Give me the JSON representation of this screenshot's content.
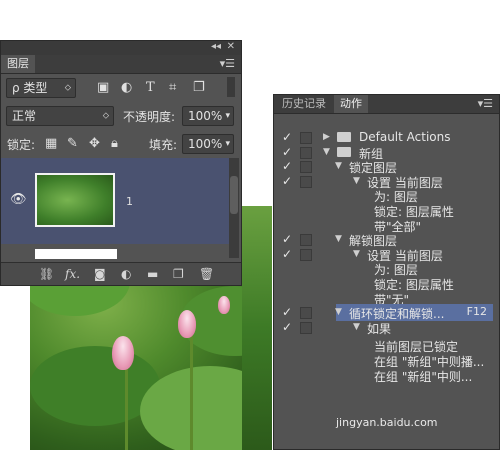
{
  "layers_panel": {
    "tab_label": "图层",
    "filter": {
      "label": "ρ 类型",
      "arrow": "⬦"
    },
    "filter_icons": [
      "image-filter-icon",
      "adjustment-filter-icon",
      "type-filter-icon",
      "shape-filter-icon",
      "smart-object-filter-icon"
    ],
    "blend_mode": "正常",
    "opacity_label": "不透明度:",
    "opacity_value": "100%",
    "lock_label": "锁定:",
    "fill_label": "填充:",
    "fill_value": "100%",
    "layer": {
      "name": "1"
    },
    "bottom_icons": [
      "link-icon",
      "fx-icon",
      "mask-icon",
      "adjustment-icon",
      "folder-icon",
      "new-layer-icon",
      "trash-icon"
    ]
  },
  "actions_panel": {
    "tabs": [
      "历史记录",
      "动作"
    ],
    "rows": [
      {
        "check": "✓",
        "indent": 0,
        "expand": "▶",
        "folder": true,
        "text": "Default Actions"
      },
      {
        "check": "✓",
        "indent": 0,
        "expand": "▼",
        "folder": true,
        "text": "新组"
      },
      {
        "check": "✓",
        "indent": 1,
        "expand": "▼",
        "folder": false,
        "text": "锁定图层"
      },
      {
        "check": "✓",
        "indent": 2,
        "expand": "▼",
        "folder": false,
        "text": "设置 当前图层"
      },
      {
        "check": "",
        "indent": 3,
        "expand": "",
        "folder": false,
        "text": "为: 图层"
      },
      {
        "check": "",
        "indent": 3,
        "expand": "",
        "folder": false,
        "text": "锁定: 图层属性"
      },
      {
        "check": "",
        "indent": 3,
        "expand": "",
        "folder": false,
        "text": "带\"全部\""
      },
      {
        "check": "✓",
        "indent": 1,
        "expand": "▼",
        "folder": false,
        "text": "解锁图层"
      },
      {
        "check": "✓",
        "indent": 2,
        "expand": "▼",
        "folder": false,
        "text": "设置 当前图层"
      },
      {
        "check": "",
        "indent": 3,
        "expand": "",
        "folder": false,
        "text": "为: 图层"
      },
      {
        "check": "",
        "indent": 3,
        "expand": "",
        "folder": false,
        "text": "锁定: 图层属性"
      },
      {
        "check": "",
        "indent": 3,
        "expand": "",
        "folder": false,
        "text": "带\"无\""
      },
      {
        "check": "✓",
        "indent": 1,
        "expand": "▼",
        "folder": false,
        "text": "循环锁定和解锁...",
        "selected": true,
        "fkey": "F12"
      },
      {
        "check": "✓",
        "indent": 2,
        "expand": "▼",
        "folder": false,
        "text": "如果"
      },
      {
        "check": "",
        "indent": 3,
        "expand": "",
        "folder": false,
        "text": "当前图层已锁定"
      },
      {
        "check": "",
        "indent": 3,
        "expand": "",
        "folder": false,
        "text": "在组 \"新组\"中则播..."
      },
      {
        "check": "",
        "indent": 3,
        "expand": "",
        "folder": false,
        "text": "在组 \"新组\"中则..."
      }
    ]
  },
  "watermark": "jingyan.baidu.com"
}
